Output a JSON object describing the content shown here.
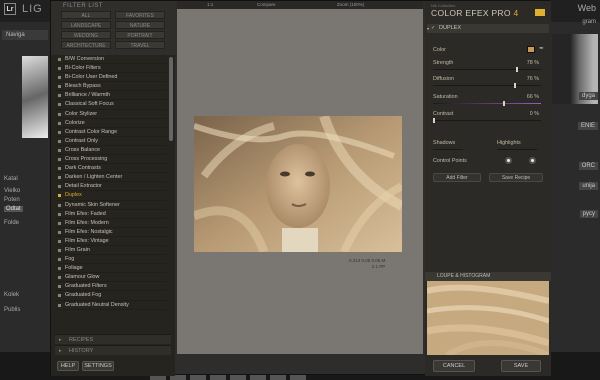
{
  "app": {
    "logo": "Lr",
    "title": "LIG",
    "module_right": "Web"
  },
  "lightroom_left": {
    "navigator": "Naviga",
    "catalog": "Katal",
    "items": [
      "Vielko",
      "Poten",
      "Odtat"
    ],
    "folders": "Folde",
    "collections": "Kolek",
    "publish": "Publis"
  },
  "lightroom_right": {
    "histogram": "gram",
    "develop": "dyga",
    "tags": [
      "ENIE",
      "ORC",
      "unija",
      "pycy"
    ]
  },
  "plugin": {
    "filter_panel": {
      "title": "FILTER LIST",
      "categories": [
        "ALL",
        "FAVORITES",
        "LANDSCAPE",
        "NATURE",
        "WEDDING",
        "PORTRAIT",
        "ARCHITECTURE",
        "TRAVEL"
      ],
      "filters": [
        "B/W Conversion",
        "Bi-Color Filters",
        "Bi-Color User Defined",
        "Bleach Bypass",
        "Brilliance / Warmth",
        "Classical Soft Focus",
        "Color Stylizer",
        "Colorize",
        "Contrast Color Range",
        "Contrast Only",
        "Cross Balance",
        "Cross Processing",
        "Dark Contrasts",
        "Darken / Lighten Center",
        "Detail Extractor",
        "Duplex",
        "Dynamic Skin Softener",
        "Film Efex: Faded",
        "Film Efex: Modern",
        "Film Efex: Nostalgic",
        "Film Efex: Vintage",
        "Film Grain",
        "Fog",
        "Foliage",
        "Glamour Glow",
        "Graduated Filters",
        "Graduated Fog",
        "Graduated Neutral Density"
      ],
      "selected_filter": "Duplex",
      "sections": [
        "RECIPES",
        "HISTORY"
      ],
      "buttons": {
        "help": "HELP",
        "settings": "SETTINGS"
      }
    },
    "preview": {
      "toolbar": [
        "1:1",
        "Compare",
        "Zoom (100%)"
      ],
      "caption_line1": "0.213 0.05 0.06 M",
      "caption_line2": "2.1 PP"
    },
    "controls": {
      "brand_small": "Nik Collection",
      "brand": "COLOR EFEX PRO",
      "brand_version": "4",
      "filter_name": "DUPLEX",
      "color_label": "Color",
      "color_swatch": "#c79a5a",
      "sliders": [
        {
          "label": "Strength",
          "value": "78 %",
          "level": 0.78
        },
        {
          "label": "Diffusion",
          "value": "76 %",
          "level": 0.76
        },
        {
          "label": "Saturation",
          "value": "66 %",
          "level": 0.66
        },
        {
          "label": "Contrast",
          "value": "0 %",
          "level": 0.0
        }
      ],
      "shadows_label": "Shadows",
      "highlights_label": "Highlights",
      "control_points_label": "Control Points",
      "add_filter": "Add Filter",
      "save_recipe": "Save Recipe",
      "loupe_title": "LOUPE & HISTOGRAM"
    },
    "bottom_buttons": {
      "cancel": "CANCEL",
      "save": "SAVE"
    }
  },
  "colors": {
    "accent": "#e0a830",
    "panel": "#2c2a26",
    "preview_bg": "#7a7772"
  }
}
